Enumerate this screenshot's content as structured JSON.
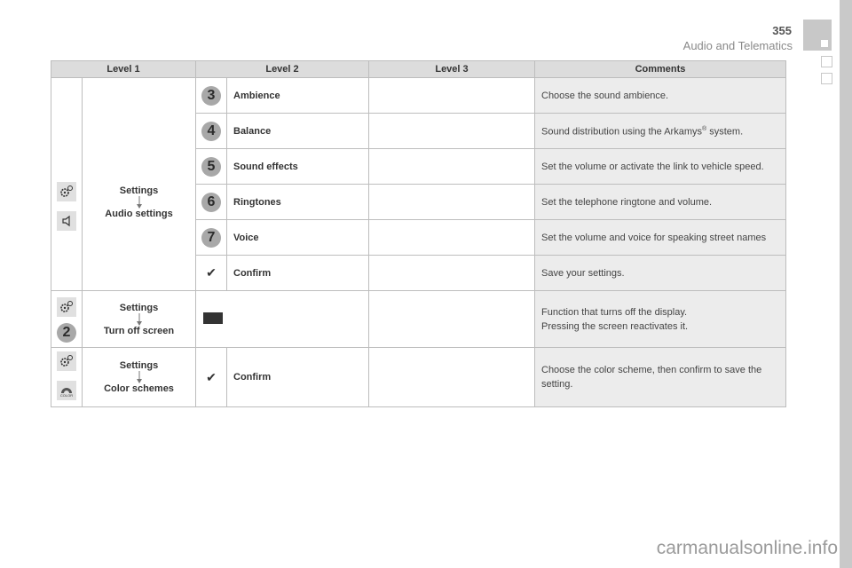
{
  "header": {
    "page_number": "355",
    "section_title": "Audio and Telematics"
  },
  "table": {
    "columns": [
      "Level 1",
      "Level 2",
      "Level 3",
      "Comments"
    ],
    "audio_group": {
      "level1_top": "Settings",
      "level1_bottom": "Audio settings",
      "icons": [
        "settings-icon",
        "speaker-icon"
      ],
      "rows": [
        {
          "marker": "3",
          "marker_type": "number-badge",
          "level2": "Ambience",
          "level3": "",
          "comment": "Choose the sound ambience."
        },
        {
          "marker": "4",
          "marker_type": "number-badge",
          "level2": "Balance",
          "level3": "",
          "comment_pre": "Sound distribution using the Arkamys",
          "comment_sup": "®",
          "comment_post": " system."
        },
        {
          "marker": "5",
          "marker_type": "number-badge",
          "level2": "Sound effects",
          "level3": "",
          "comment": "Set the volume or activate the link to vehicle speed."
        },
        {
          "marker": "6",
          "marker_type": "number-badge",
          "level2": "Ringtones",
          "level3": "",
          "comment": "Set the telephone ringtone and volume."
        },
        {
          "marker": "7",
          "marker_type": "number-badge",
          "level2": "Voice",
          "level3": "",
          "comment": "Set the volume and voice for speaking street names"
        },
        {
          "marker": "✔",
          "marker_type": "check-icon",
          "level2": "Confirm",
          "level3": "",
          "comment": "Save your settings."
        }
      ]
    },
    "screen_row": {
      "level1_top": "Settings",
      "level1_bottom": "Turn off screen",
      "icons": [
        "settings-icon"
      ],
      "badge": "2",
      "level2_icon": "screen-off-icon",
      "comment_line1": "Function that turns off the display.",
      "comment_line2": "Pressing the screen reactivates it."
    },
    "color_row": {
      "level1_top": "Settings",
      "level1_bottom": "Color schemes",
      "icons": [
        "settings-icon",
        "color-icon"
      ],
      "color_icon_label": "COLOR",
      "marker": "✔",
      "level2": "Confirm",
      "comment": "Choose the color scheme, then confirm to save the setting."
    }
  },
  "watermark": "carmanualsonline.info"
}
